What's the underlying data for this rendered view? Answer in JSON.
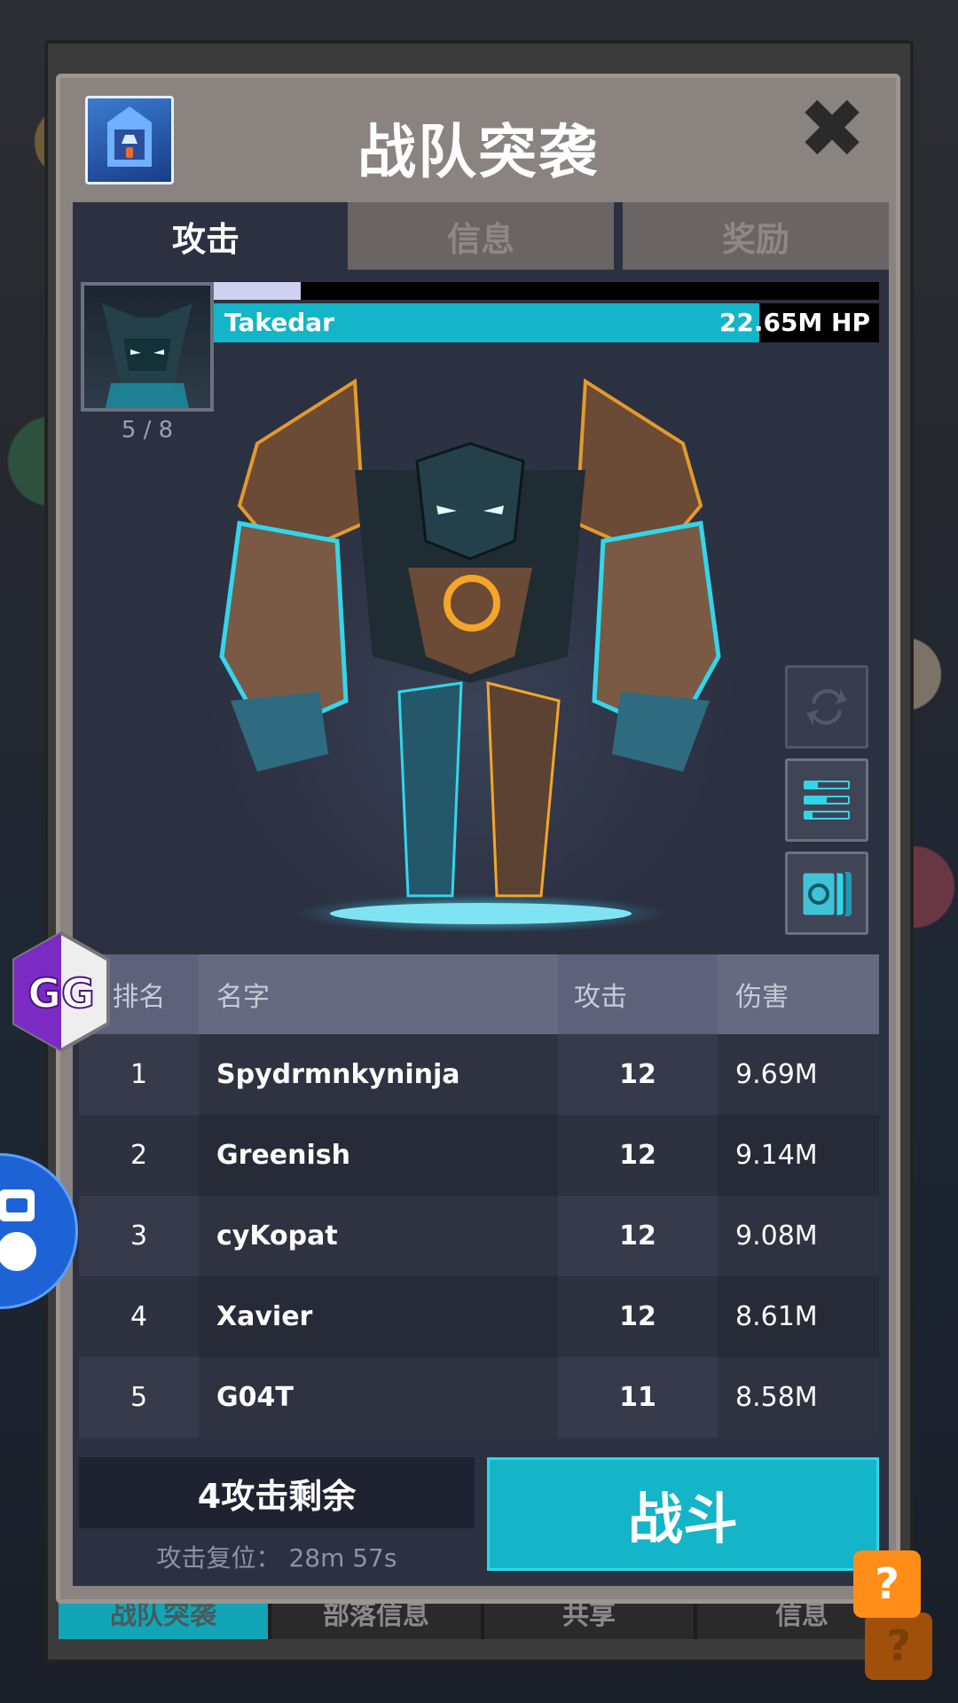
{
  "dialog": {
    "title": "战队突袭",
    "close_glyph": "✖"
  },
  "tabs": [
    {
      "label": "攻击",
      "active": true
    },
    {
      "label": "信息",
      "active": false
    },
    {
      "label": "奖励",
      "active": false
    }
  ],
  "boss": {
    "name": "Takedar",
    "hp_text": "22.65M HP",
    "hp_fraction": 0.82,
    "stage_fraction": 0.13,
    "count": "5 / 8"
  },
  "table": {
    "headers": [
      "排名",
      "名字",
      "攻击",
      "伤害"
    ],
    "rows": [
      {
        "rank": "1",
        "name": "Spydrmnkyninja",
        "attacks": "12",
        "damage": "9.69M"
      },
      {
        "rank": "2",
        "name": "Greenish",
        "attacks": "12",
        "damage": "9.14M"
      },
      {
        "rank": "3",
        "name": "cyKopat",
        "attacks": "12",
        "damage": "9.08M"
      },
      {
        "rank": "4",
        "name": "Xavier",
        "attacks": "12",
        "damage": "8.61M"
      },
      {
        "rank": "5",
        "name": "G04T",
        "attacks": "11",
        "damage": "8.58M"
      }
    ]
  },
  "actions": {
    "remaining": "4攻击剩余",
    "reset_label": "攻击复位：",
    "reset_time": "28m 57s",
    "fight": "战斗"
  },
  "bottom_nav": [
    "战队突袭",
    "部落信息",
    "共享",
    "信息"
  ],
  "overlay": {
    "gg_text": "GG",
    "help_glyph": "?"
  },
  "colors": {
    "accent": "#14b4c9",
    "panel": "#2c3142",
    "help": "#ff8d18"
  }
}
